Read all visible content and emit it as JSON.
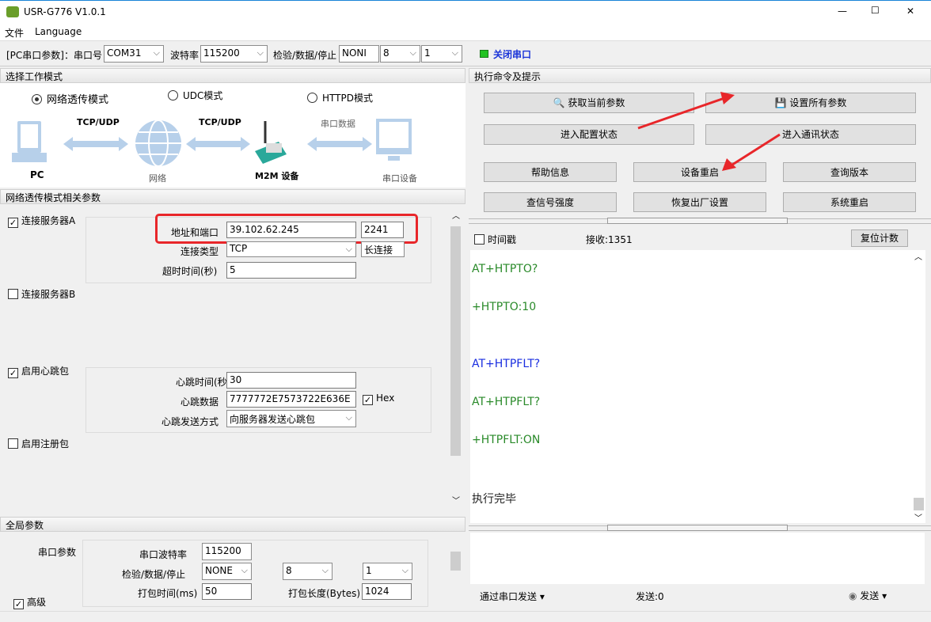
{
  "window": {
    "title": "USR-G776 V1.0.1",
    "min": "—",
    "max": "☐",
    "close": "✕"
  },
  "menu": [
    "文件",
    "Language"
  ],
  "toolbar": {
    "pc_label": "[PC串口参数]：串口号",
    "port": "COM31",
    "baud_label": "波特率",
    "baud": "115200",
    "parity_label": "检验/数据/停止",
    "parity": "NONI",
    "data": "8",
    "stop": "1",
    "close_port": "关闭串口",
    "led_color": "#22c322"
  },
  "mode": {
    "header": "选择工作模式",
    "options": [
      {
        "label": "网络透传模式",
        "selected": true
      },
      {
        "label": "UDC模式",
        "selected": false
      },
      {
        "label": "HTTPD模式",
        "selected": false
      }
    ],
    "diagram": {
      "pc": "PC",
      "link1": "TCP/UDP",
      "net": "网络",
      "link2": "TCP/UDP",
      "m2m": "M2M 设备",
      "link3": "串口数据",
      "serial": "串口设备"
    }
  },
  "params": {
    "header": "网络透传模式相关参数",
    "serverA": {
      "label": "连接服务器A",
      "checked": true,
      "addr_label": "地址和端口",
      "addr": "39.102.62.245",
      "port": "2241",
      "type_label": "连接类型",
      "type": "TCP",
      "conn": "长连接",
      "timeout_label": "超时时间(秒)",
      "timeout": "5"
    },
    "serverB": {
      "label": "连接服务器B",
      "checked": false
    },
    "heartbeat": {
      "label": "启用心跳包",
      "checked": true,
      "time_label": "心跳时间(秒)",
      "time": "30",
      "data_label": "心跳数据",
      "data": "7777772E7573722E636E",
      "hex_label": "Hex",
      "hex": true,
      "mode_label": "心跳发送方式",
      "mode": "向服务器发送心跳包"
    },
    "register": {
      "label": "启用注册包",
      "checked": false
    }
  },
  "global": {
    "header": "全局参数",
    "serial_label": "串口参数",
    "baud_label": "串口波特率",
    "baud": "115200",
    "parity_label": "检验/数据/停止",
    "parity": "NONE",
    "data": "8",
    "stop": "1",
    "pack_time_label": "打包时间(ms)",
    "pack_time": "50",
    "pack_len_label": "打包长度(Bytes)",
    "pack_len": "1024",
    "advanced": "高级"
  },
  "commands": {
    "header": "执行命令及提示",
    "get": "获取当前参数",
    "set": "设置所有参数",
    "enter_cfg": "进入配置状态",
    "enter_comm": "进入通讯状态",
    "help": "帮助信息",
    "restart": "设备重启",
    "version": "查询版本",
    "signal": "查信号强度",
    "factory": "恢复出厂设置",
    "sys_restart": "系统重启"
  },
  "log": {
    "timestamp": "时间戳",
    "recv": "接收:1351",
    "reset": "复位计数",
    "lines": [
      {
        "text": "AT+HTPTO?",
        "color": "#2a8a2a"
      },
      {
        "text": "+HTPTO:10",
        "color": "#2a8a2a"
      },
      {
        "text": "AT+HTPFLT?",
        "color": "#1a2ee0"
      },
      {
        "text": "AT+HTPFLT?",
        "color": "#2a8a2a"
      },
      {
        "text": "+HTPFLT:ON",
        "color": "#2a8a2a"
      },
      {
        "text": "执行完毕",
        "color": "#222222"
      }
    ]
  },
  "send": {
    "via": "通过串口发送",
    "count": "发送:0",
    "send": "发送"
  }
}
